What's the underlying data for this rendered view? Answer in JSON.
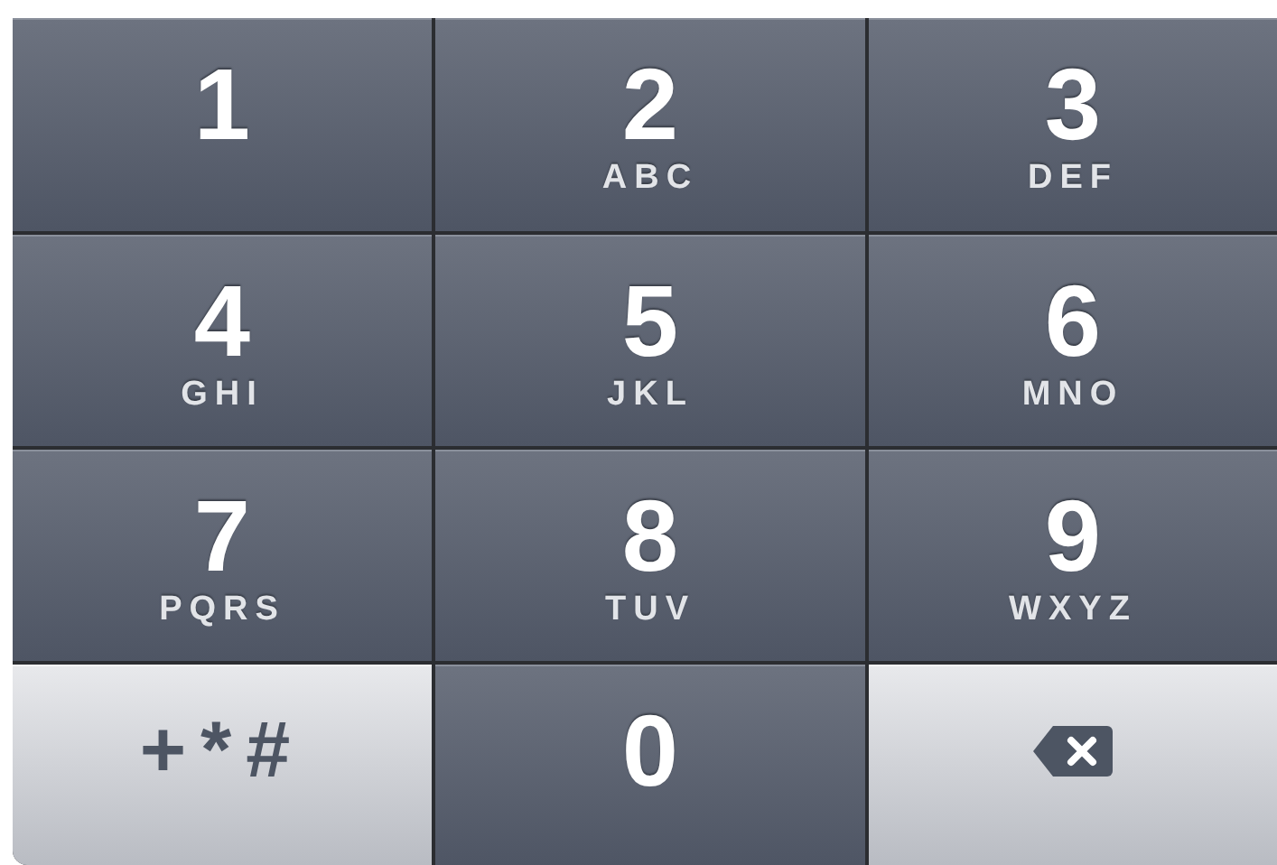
{
  "keys": [
    {
      "kind": "digit",
      "digit": "1"
    },
    {
      "kind": "digit",
      "digit": "2",
      "letters": "ABC"
    },
    {
      "kind": "digit",
      "digit": "3",
      "letters": "DEF"
    },
    {
      "kind": "digit",
      "digit": "4",
      "letters": "GHI"
    },
    {
      "kind": "digit",
      "digit": "5",
      "letters": "JKL"
    },
    {
      "kind": "digit",
      "digit": "6",
      "letters": "MNO"
    },
    {
      "kind": "digit",
      "digit": "7",
      "letters": "PQRS"
    },
    {
      "kind": "digit",
      "digit": "8",
      "letters": "TUV"
    },
    {
      "kind": "digit",
      "digit": "9",
      "letters": "WXYZ"
    },
    {
      "kind": "symbols",
      "label": "+*#"
    },
    {
      "kind": "digit",
      "digit": "0"
    },
    {
      "kind": "delete"
    }
  ]
}
